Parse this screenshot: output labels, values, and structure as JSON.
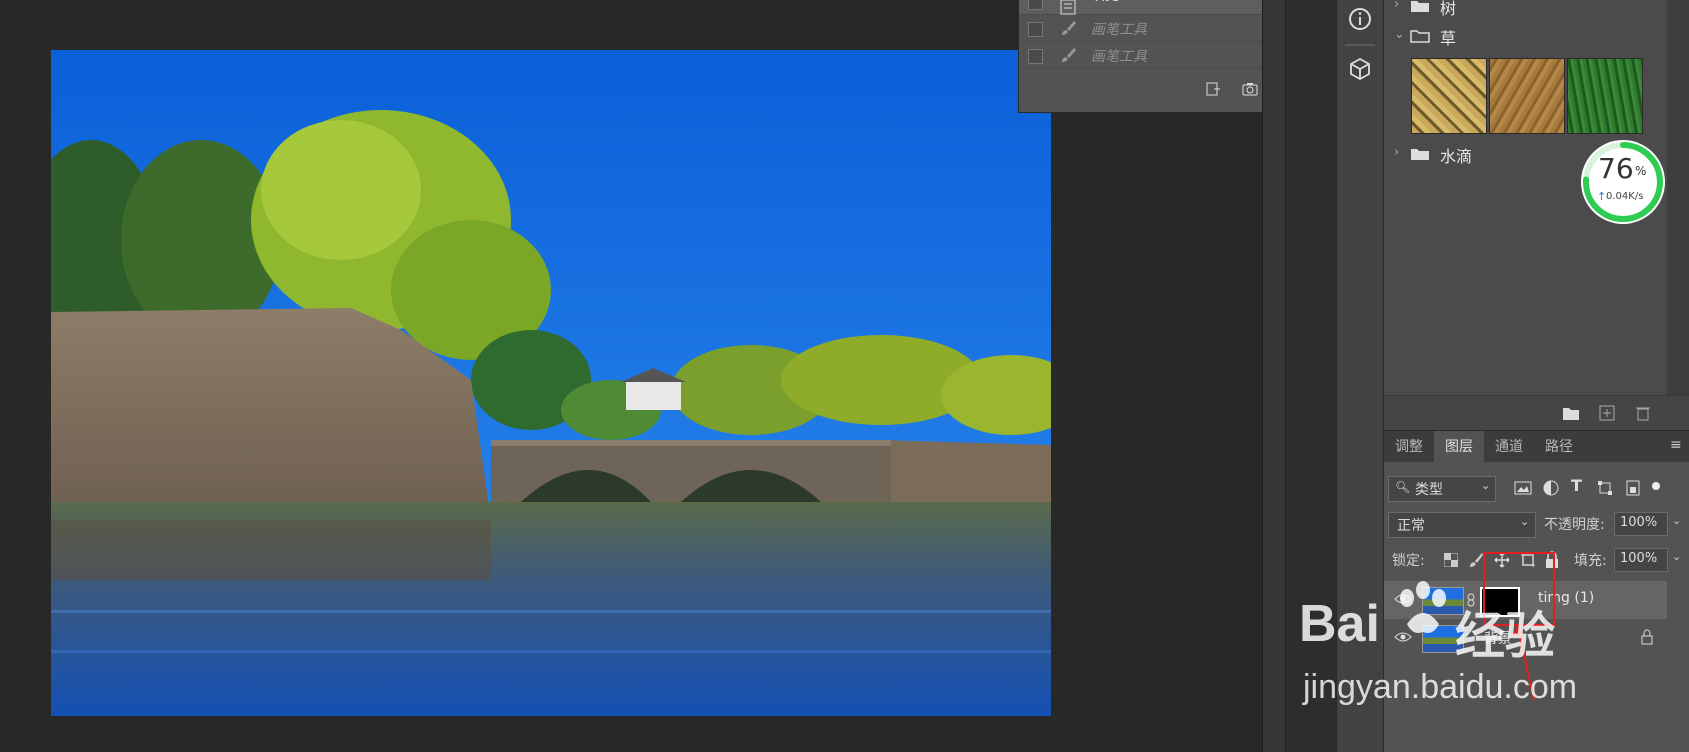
{
  "history": {
    "rows": [
      {
        "label": "填充"
      },
      {
        "label": "画笔工具"
      },
      {
        "label": "画笔工具"
      }
    ],
    "footer_icons": [
      "new-document-from-state-icon",
      "camera-snapshot-icon",
      "trash-icon"
    ]
  },
  "tools": {
    "icons": [
      "info-icon",
      "3d-cube-icon"
    ]
  },
  "swatches": {
    "groups": [
      {
        "label": "树",
        "expanded": false
      },
      {
        "label": "草",
        "expanded": true
      },
      {
        "label": "水滴",
        "expanded": false
      }
    ],
    "grass_colors": [
      "#c9a85c",
      "#a57a3b",
      "#2f7a2c"
    ],
    "footer_icons": [
      "new-group-icon",
      "new-swatch-icon",
      "delete-icon"
    ]
  },
  "speed_widget": {
    "percent": "76",
    "percent_sign": "%",
    "rate": "0.04K/s",
    "ring_color": "#2ecc52"
  },
  "layers": {
    "tabs": [
      "调整",
      "图层",
      "通道",
      "路径"
    ],
    "active_tab": "图层",
    "filter_label": "类型",
    "blend_mode": "正常",
    "opacity_label": "不透明度:",
    "opacity_value": "100%",
    "lock_label": "锁定:",
    "fill_label": "填充:",
    "fill_value": "100%",
    "items": [
      {
        "name": "timg (1)",
        "visible": true,
        "selected": true
      },
      {
        "name": "背景",
        "visible": true,
        "locked": true
      }
    ]
  },
  "watermark": {
    "brand_left": "Bai",
    "brand_right": "经验",
    "url": "jingyan.baidu.com"
  }
}
